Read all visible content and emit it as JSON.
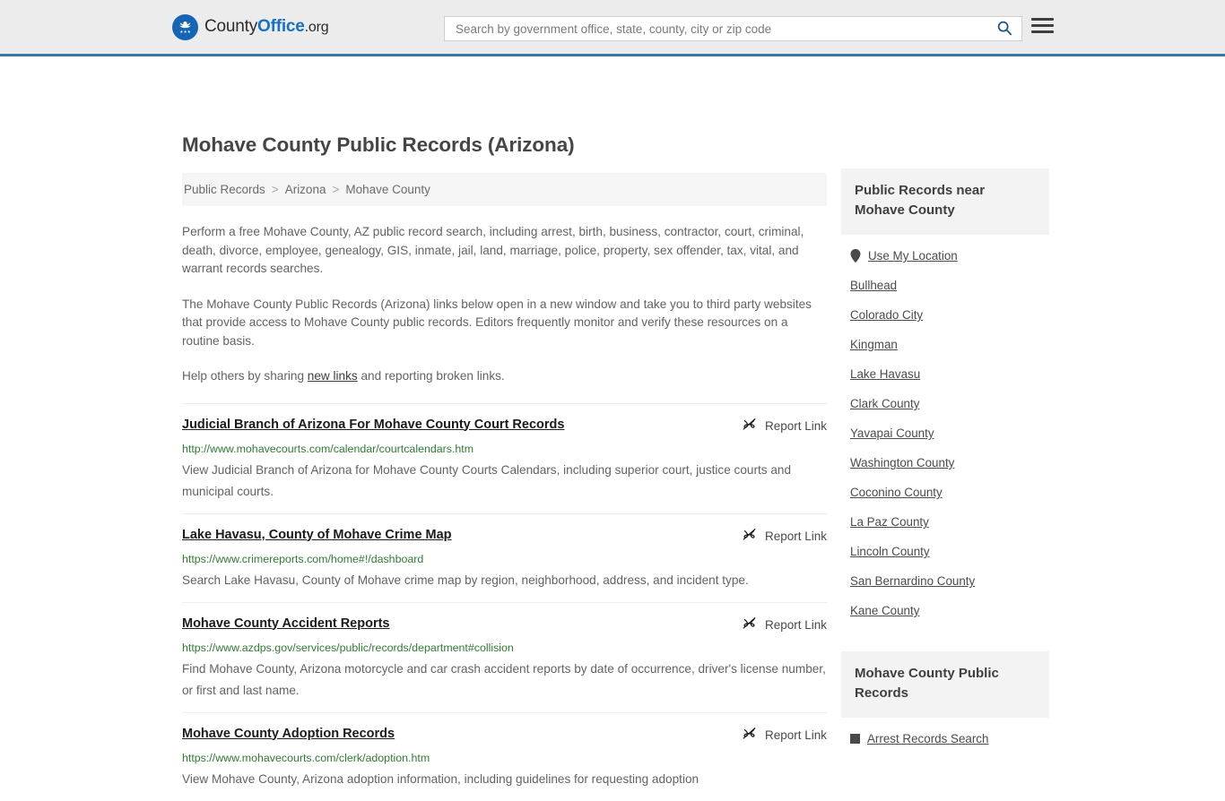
{
  "header": {
    "logo": {
      "part1": "County",
      "part2": "Office",
      "part3": ".org",
      "icon": "eagle-seal-icon"
    },
    "search": {
      "placeholder": "Search by government office, state, county, city or zip code",
      "value": "",
      "icon": "search-icon"
    },
    "menu_icon": "hamburger-menu-icon",
    "accent_color": "#3a76a8",
    "background_color": "#ececec"
  },
  "main": {
    "title": "Mohave County Public Records (Arizona)",
    "breadcrumb": [
      {
        "label": "Public Records"
      },
      {
        "label": "Arizona"
      },
      {
        "label": "Mohave County"
      }
    ],
    "breadcrumb_separator": ">",
    "paragraph_1": "Perform a free Mohave County, AZ public record search, including arrest, birth, business, contractor, court, criminal, death, divorce, employee, genealogy, GIS, inmate, jail, land, marriage, police, property, sex offender, tax, vital, and warrant records searches.",
    "paragraph_2": "The Mohave County Public Records (Arizona) links below open in a new window and take you to third party websites that provide access to Mohave County public records. Editors frequently monitor and verify these resources on a routine basis.",
    "help_prefix": "Help others by sharing ",
    "help_link": "new links",
    "help_suffix": " and reporting broken links.",
    "report_link_label": "Report Link",
    "report_link_icon": "broken-link-icon",
    "url_color": "#2f7d32",
    "records": [
      {
        "title": "Judicial Branch of Arizona For Mohave County Court Records",
        "url": "http://www.mohavecourts.com/calendar/courtcalendars.htm",
        "description": "View Judicial Branch of Arizona for Mohave County Courts Calendars, including superior court, justice courts and municipal courts."
      },
      {
        "title": "Lake Havasu, County of Mohave Crime Map",
        "url": "https://www.crimereports.com/home#!/dashboard",
        "description": "Search Lake Havasu, County of Mohave crime map by region, neighborhood, address, and incident type."
      },
      {
        "title": "Mohave County Accident Reports",
        "url": "https://www.azdps.gov/services/public/records/department#collision",
        "description": "Find Mohave County, Arizona motorcycle and car crash accident reports by date of occurrence, driver's license number, or first and last name."
      },
      {
        "title": "Mohave County Adoption Records",
        "url": "https://www.mohavecourts.com/clerk/adoption.htm",
        "description": "View Mohave County, Arizona adoption information, including guidelines for requesting adoption"
      }
    ]
  },
  "sidebar": {
    "nearby": {
      "heading": "Public Records near Mohave County",
      "use_my_location": "Use My Location",
      "location_icon": "map-pin-icon",
      "items": [
        {
          "label": "Bullhead"
        },
        {
          "label": "Colorado City"
        },
        {
          "label": "Kingman"
        },
        {
          "label": "Lake Havasu"
        },
        {
          "label": "Clark County"
        },
        {
          "label": "Yavapai County"
        },
        {
          "label": "Washington County"
        },
        {
          "label": "Coconino County"
        },
        {
          "label": "La Paz County"
        },
        {
          "label": "Lincoln County"
        },
        {
          "label": "San Bernardino County"
        },
        {
          "label": "Kane County"
        }
      ]
    },
    "county_records": {
      "heading": "Mohave County Public Records",
      "items": [
        {
          "label": "Arrest Records Search"
        }
      ]
    }
  }
}
